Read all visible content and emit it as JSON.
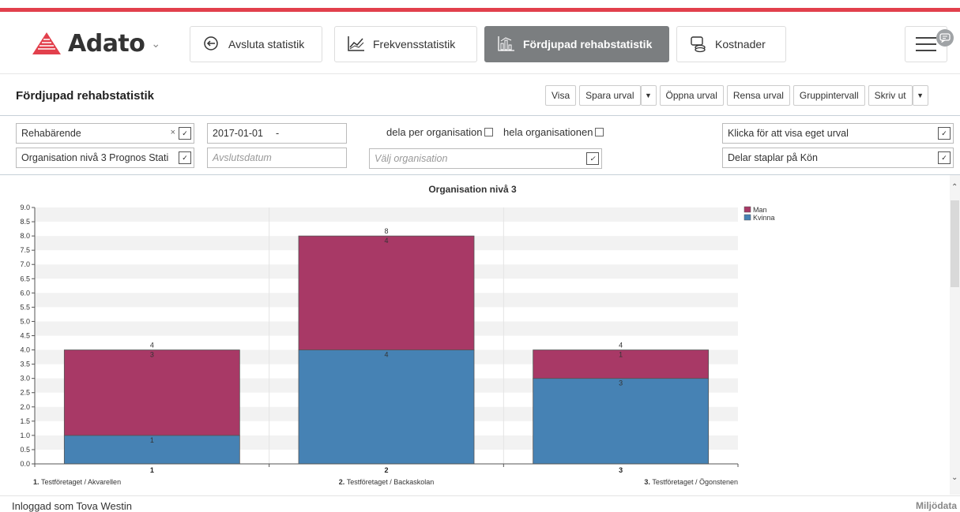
{
  "app": {
    "logo_text": "Adato",
    "brand_color": "#e2404c"
  },
  "nav": [
    {
      "label": "Avsluta statistik",
      "icon": "exit-icon",
      "active": false
    },
    {
      "label": "Frekvensstatistik",
      "icon": "line-chart-icon",
      "active": false
    },
    {
      "label": "Fördjupad rehabstatistik",
      "icon": "bar-chart-icon",
      "active": true
    },
    {
      "label": "Kostnader",
      "icon": "coins-icon",
      "active": false
    }
  ],
  "page": {
    "title": "Fördjupad rehabstatistik"
  },
  "toolbar": {
    "visa": "Visa",
    "spara": "Spara urval",
    "oppna": "Öppna urval",
    "rensa": "Rensa urval",
    "grupp": "Gruppintervall",
    "skriv": "Skriv ut"
  },
  "filters": {
    "type_select": "Rehabärende",
    "level_select": "Organisation nivå 3 Prognos Stati",
    "start_date": "2017-01-01",
    "date_sep": "-",
    "end_date_placeholder": "Avslutsdatum",
    "dela_label": "dela per organisation",
    "hela_label": "hela organisationen",
    "org_placeholder": "Välj organisation",
    "urval_select": "Klicka för att visa eget urval",
    "split_select": "Delar staplar på Kön"
  },
  "chart_data": {
    "type": "bar",
    "stacked": true,
    "title": "Organisation nivå 3",
    "categories": [
      "1",
      "2",
      "3"
    ],
    "category_labels": [
      {
        "num": "1.",
        "text": "Testföretaget / Akvarellen"
      },
      {
        "num": "2.",
        "text": "Testföretaget / Backaskolan"
      },
      {
        "num": "3.",
        "text": "Testföretaget / Ögonstenen"
      }
    ],
    "series": [
      {
        "name": "Kvinna",
        "values": [
          1,
          4,
          3
        ],
        "color": "#4682b4"
      },
      {
        "name": "Man",
        "values": [
          3,
          4,
          1
        ],
        "color": "#a83966"
      }
    ],
    "totals": [
      4,
      8,
      4
    ],
    "ylim": [
      0,
      9
    ],
    "yticks": [
      "0.0",
      "0.5",
      "1.0",
      "1.5",
      "2.0",
      "2.5",
      "3.0",
      "3.5",
      "4.0",
      "4.5",
      "5.0",
      "5.5",
      "6.0",
      "6.5",
      "7.0",
      "7.5",
      "8.0",
      "8.5",
      "9.0"
    ],
    "legend": [
      "Man",
      "Kvinna"
    ],
    "legend_position": "top-right",
    "grid": true
  },
  "footer": {
    "logged_in": "Inloggad som Tova Westin",
    "brand": "Miljödata"
  }
}
